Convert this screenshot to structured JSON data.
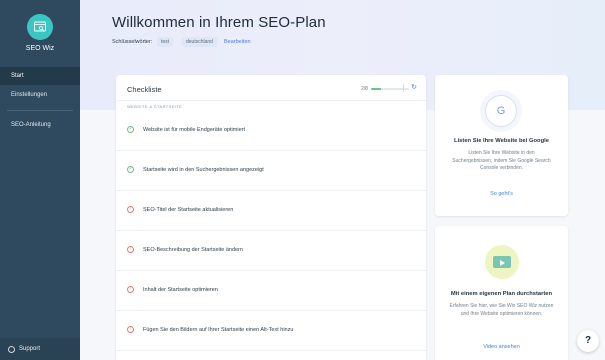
{
  "app": {
    "name": "SEO Wiz",
    "accent": "#3bc6c4",
    "sidebar_bg": "#2f4a5e"
  },
  "sidebar": {
    "items": [
      {
        "label": "Start",
        "active": true
      },
      {
        "label": "Einstellungen",
        "active": false
      },
      {
        "label": "SEO-Anleitung",
        "active": false
      }
    ],
    "support_label": "Support"
  },
  "header": {
    "title": "Willkommen in Ihrem SEO-Plan",
    "keywords_label": "Schlüsselwörter:",
    "keywords": [
      "test",
      "deutschland"
    ],
    "edit_label": "Bearbeiten"
  },
  "checklist": {
    "title": "Checkliste",
    "count_text": "2/8",
    "progress": 0.25,
    "section_label": "WEBSITE & STARTSEITE",
    "items": [
      {
        "text": "Website ist für mobile Endgeräte optimiert",
        "status": "done"
      },
      {
        "text": "Startseite wird in den Suchergebnissen angezeigt",
        "status": "done"
      },
      {
        "text": "SEO-Titel der Startseite aktualisieren",
        "status": "todo"
      },
      {
        "text": "SEO-Beschreibung der Startseite ändern",
        "status": "todo"
      },
      {
        "text": "Inhalt der Startseite optimieren",
        "status": "todo"
      },
      {
        "text": "Fügen Sie den Bildern auf Ihrer Startseite einen Alt-Text hinzu",
        "status": "todo"
      }
    ]
  },
  "google_card": {
    "icon_letter": "G",
    "title": "Listen Sie Ihre Website bei Google",
    "description": "Listen Sie Ihre Website in den Suchergebnissen, indem Sie Google Search Console verbinden.",
    "link": "So geht's"
  },
  "plan_card": {
    "title": "Mit einem eigenen Plan durchstarten",
    "description": "Erfahren Sie hier, wie Sie Wix SEO Wiz nutzen und Ihre Website optimieren können.",
    "link": "Video ansehen"
  },
  "help_button": {
    "label": "?"
  }
}
